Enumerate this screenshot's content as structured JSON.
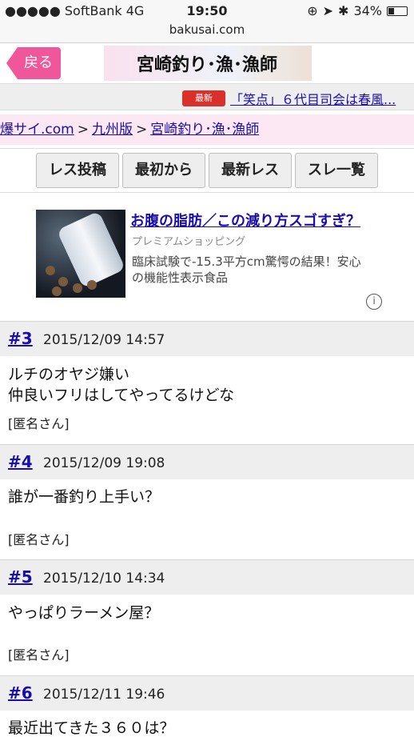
{
  "status_bar": {
    "carrier": "●●●●● SoftBank  4G",
    "time": "19:50",
    "battery_text": "34%",
    "battery_level": 0.34
  },
  "url": "bakusai.com",
  "header": {
    "back_label": "戻る",
    "title": "宮崎釣り･漁･漁師"
  },
  "news": {
    "badge": "最新NEWS",
    "text": "「笑点」６代目司会は春風..."
  },
  "breadcrumb": {
    "items": [
      "爆サイ.com",
      "九州版",
      "宮崎釣り･漁･漁師"
    ],
    "separator": ">"
  },
  "buttons": [
    "レス投稿",
    "最初から",
    "最新レス",
    "スレ一覧"
  ],
  "ad": {
    "title": "お腹の脂肪／この減り方スゴすぎ？",
    "source": "プレミアムショッピング",
    "description": "臨床試験で-15.3平方cm驚愕の結果！安心の機能性表示食品"
  },
  "posts": [
    {
      "num": "#3",
      "date": "2015/12/09 14:57",
      "body": [
        "ルチのオヤジ嫌い",
        "仲良いフリはしてやってるけどな"
      ],
      "author": "[匿名さん]"
    },
    {
      "num": "#4",
      "date": "2015/12/09 19:08",
      "body": [
        "誰が一番釣り上手い？"
      ],
      "author": "[匿名さん]"
    },
    {
      "num": "#5",
      "date": "2015/12/10 14:34",
      "body": [
        "やっぱりラーメン屋？"
      ],
      "author": "[匿名さん]"
    },
    {
      "num": "#6",
      "date": "2015/12/11 19:46",
      "body": [
        "最近出てきた３６０は？"
      ],
      "author": ""
    }
  ],
  "colors": {
    "accent": "#f0569a",
    "link": "#1a0dab",
    "breadcrumb_bg": "#fce8f2"
  },
  "icons": {
    "info": "info-icon",
    "battery": "battery-icon",
    "location": "location-icon",
    "bluetooth": "bluetooth-icon"
  }
}
